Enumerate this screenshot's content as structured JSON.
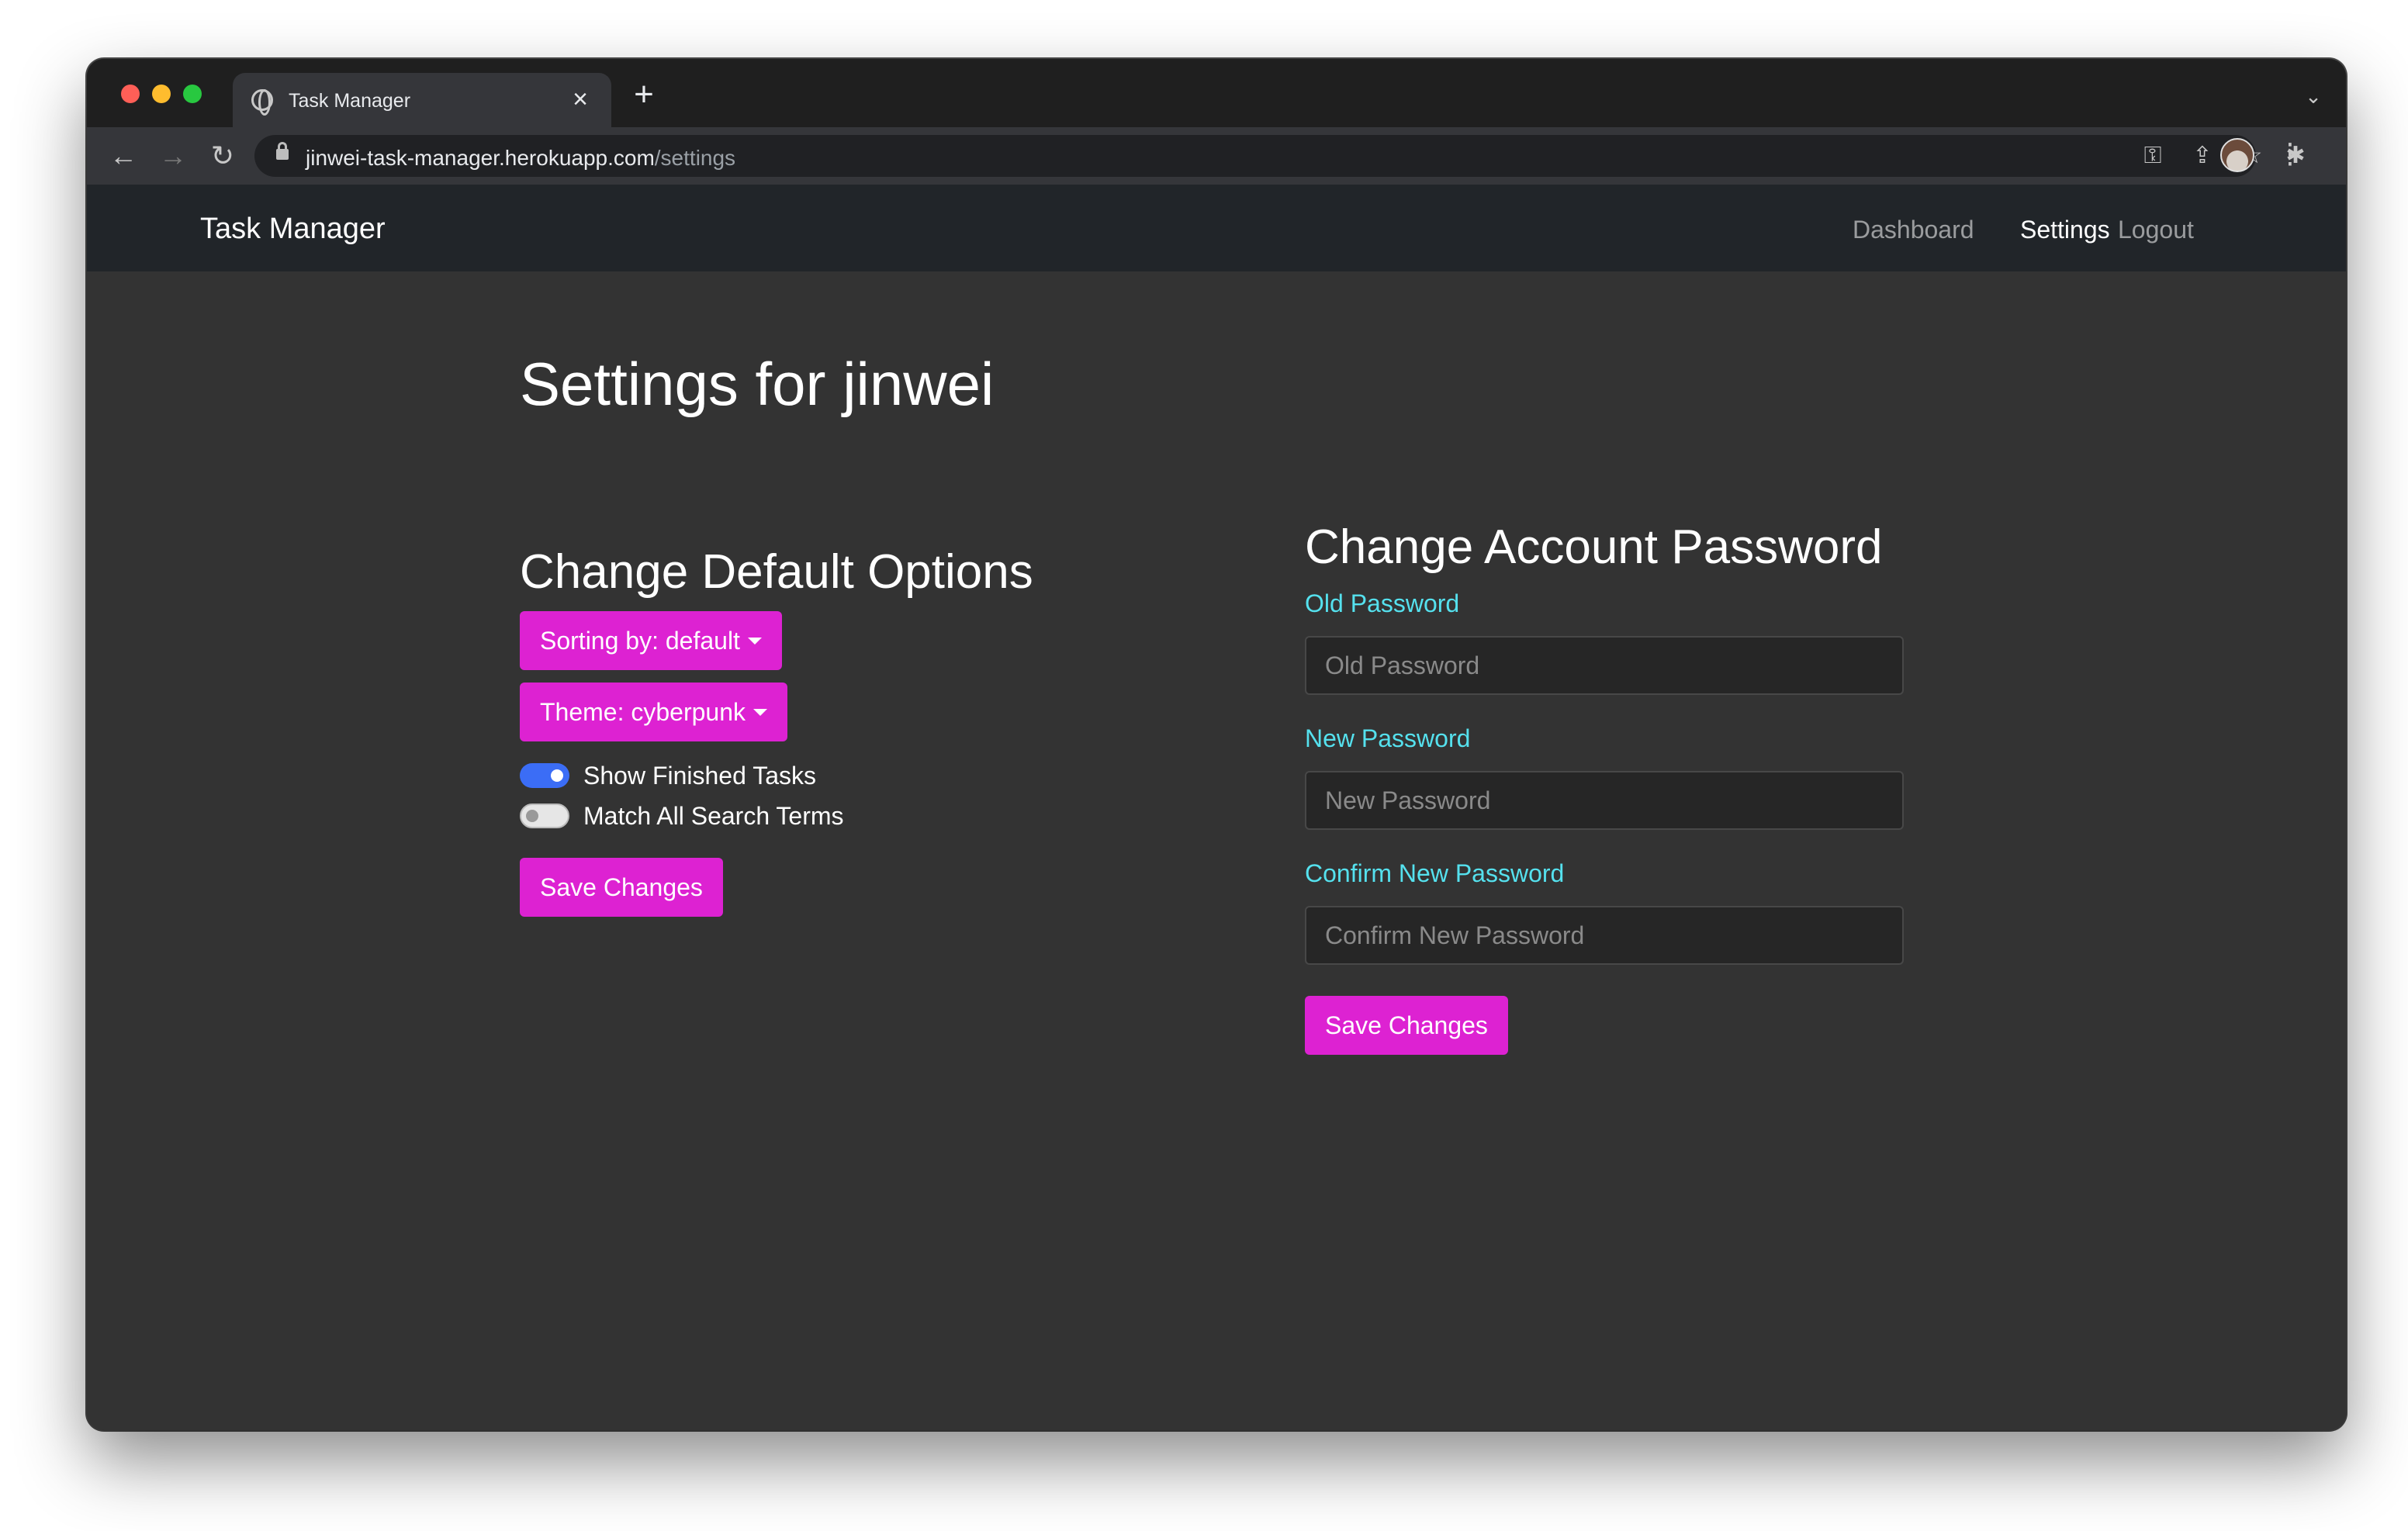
{
  "browser": {
    "tab_title": "Task Manager",
    "tab_close": "×",
    "new_tab": "+",
    "url_host": "jinwei-task-manager.herokuapp.com",
    "url_path": "/settings",
    "icons": {
      "back": "←",
      "forward": "→",
      "reload": "↻",
      "key": "⚿",
      "share": "⇪",
      "bookmark": "☆",
      "extensions": "✱",
      "menu": "⋮",
      "tabs_menu": "⌄"
    }
  },
  "navbar": {
    "brand": "Task Manager",
    "links": [
      "Dashboard",
      "Settings",
      "Logout"
    ],
    "active": "Settings"
  },
  "page": {
    "title": "Settings for jinwei"
  },
  "defaults": {
    "heading": "Change Default Options",
    "sorting_label": "Sorting by: default",
    "theme_label": "Theme: cyberpunk",
    "toggles": [
      {
        "label": "Show Finished Tasks",
        "on": true
      },
      {
        "label": "Match All Search Terms",
        "on": false
      }
    ],
    "save_label": "Save Changes"
  },
  "password": {
    "heading": "Change Account Password",
    "old_label": "Old Password",
    "old_placeholder": "Old Password",
    "new_label": "New Password",
    "new_placeholder": "New Password",
    "confirm_label": "Confirm New Password",
    "confirm_placeholder": "Confirm New Password",
    "save_label": "Save Changes"
  },
  "colors": {
    "accent": "#dd22d2",
    "label": "#55e1ee",
    "toggle_on": "#3b6df6",
    "page_bg": "#333333",
    "navbar_bg": "#212529"
  }
}
